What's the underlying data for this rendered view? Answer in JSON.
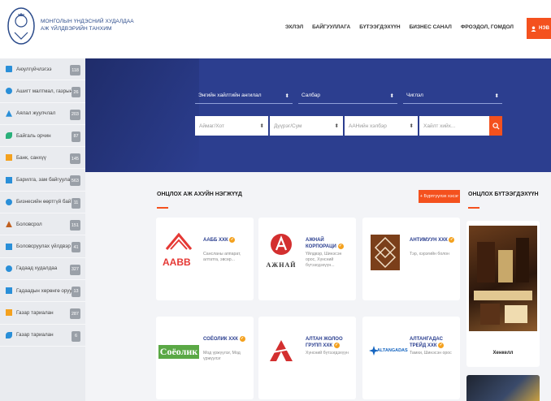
{
  "header": {
    "org_line1": "МОНГОЛЫН ҮНДЭСНИЙ ХУДАЛДАА",
    "org_line2": "АЖ ҮЙЛДВЭРИЙН ТАНХИМ",
    "nav": [
      "ЭХЛЭЛ",
      "БАЙГУУЛЛАГА",
      "БҮТЭЭГДЭХҮҮН",
      "БИЗНЕС САНАЛ",
      "ФРОЭДОЛ, ГОМДОЛ"
    ],
    "login_label": "НЭВ"
  },
  "sidebar": {
    "items": [
      {
        "label": "Аюулгүйчлэгээ",
        "count": "118",
        "icon_color": "#2a8fd8"
      },
      {
        "label": "Ашигт малтмал, газрын...",
        "count": "26",
        "icon_color": "#2a8fd8"
      },
      {
        "label": "Аялал жуулчлал",
        "count": "203",
        "icon_color": "#2a8fd8"
      },
      {
        "label": "Байгаль орчин",
        "count": "87",
        "icon_color": "#2ab07a"
      },
      {
        "label": "Банк, санхүү",
        "count": "145",
        "icon_color": "#f4a11e"
      },
      {
        "label": "Барилга, зам байгууламж",
        "count": "563",
        "icon_color": "#2a8fd8"
      },
      {
        "label": "Бизнесийн өөртгүй бай...",
        "count": "11",
        "icon_color": "#2a8fd8"
      },
      {
        "label": "Боловсрол",
        "count": "151",
        "icon_color": "#c06020"
      },
      {
        "label": "Боловсруулах үйлдвэр",
        "count": "41",
        "icon_color": "#2a8fd8"
      },
      {
        "label": "Гадаад худалдаа",
        "count": "327",
        "icon_color": "#2a8fd8"
      },
      {
        "label": "Гадаадын хөрөнгө оруу...",
        "count": "13",
        "icon_color": "#2a8fd8"
      },
      {
        "label": "Газар тариалан",
        "count": "287",
        "icon_color": "#f4a11e"
      },
      {
        "label": "Газар тариалан",
        "count": "6",
        "icon_color": "#2a8fd8"
      }
    ]
  },
  "search": {
    "row1": [
      "Энгийн хайлтийн ангилал",
      "Салбар",
      "Чиглэл"
    ],
    "row2": [
      "Аймаг/Хот",
      "Дүүрэг/Сум",
      "ААНийн хэлбэр",
      "Хайлт хийх..."
    ]
  },
  "featured": {
    "title": "ОНЦЛОХ АЖ АХУЙН НЭГЖҮҮД",
    "register_label": "+ Бүртгүүлэх хэсэг",
    "cards": [
      {
        "name": "ААББ ХХК",
        "desc": "Сансланы аппарат, алтатга, эвсөр...",
        "logo_text": "AABB",
        "logo_color": "#e53935"
      },
      {
        "name": "АЖНАЙ КОРПОРАЦИ",
        "desc": "Үйлдвэр, Шинэсэн орос, Хүнсний бүтээгдэхүүн...",
        "logo_text": "АЖНАЙ",
        "logo_color": "#d32f2f"
      },
      {
        "name": "АНТИМУУН ХХК",
        "desc": "Тэр, хэрэгийн болон",
        "logo_text": "",
        "logo_color": "#7b3f1a"
      },
      {
        "name": "СОЁОЛИК ХХК",
        "desc": "Мод үржүүлэг, Мод үржүүлэг",
        "logo_text": "Соёолик",
        "logo_color": "#e53935"
      },
      {
        "name": "АЛТАН ЖОЛОО ГРУПП ХХК",
        "desc": "Хүнсний бүтээгдэхүүн",
        "logo_text": "",
        "logo_color": "#d32f2f"
      },
      {
        "name": "АЛТАНГАДАС ТРЕЙД ХХК",
        "desc": "Тамхи, Шинэсэн орос",
        "logo_text": "ALTANGADAS",
        "logo_color": "#1565c0"
      }
    ]
  },
  "products": {
    "title": "ОНЦЛОХ БҮТЭЭГДЭХҮҮН",
    "items": [
      {
        "name": "Хенкелл"
      }
    ]
  },
  "colors": {
    "accent": "#f4511e",
    "hero": "#2c3e8f",
    "brand_text": "#2a3e8f"
  }
}
